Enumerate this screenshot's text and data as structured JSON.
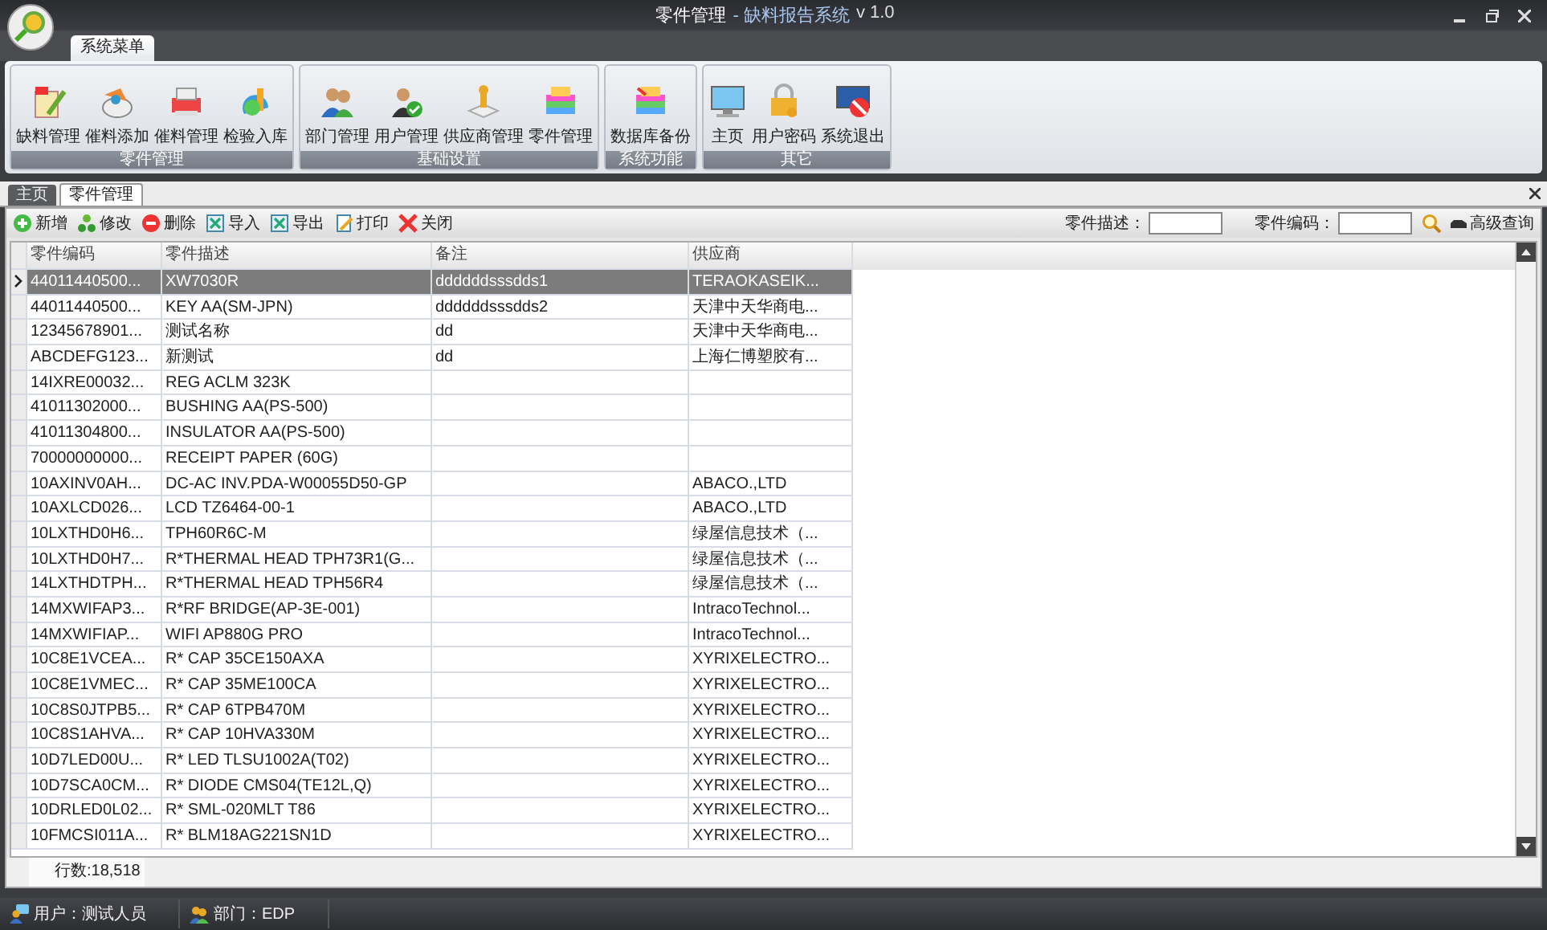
{
  "window": {
    "title": "零件管理",
    "app_name": "- 缺料报告系统",
    "version": "v 1.0"
  },
  "menu_tab": {
    "label": "系统菜单",
    "selected": true
  },
  "ribbon": [
    {
      "label": "零件管理",
      "buttons": [
        "缺料管理",
        "催料添加",
        "催料管理",
        "检验入库"
      ]
    },
    {
      "label": "基础设置",
      "buttons": [
        "部门管理",
        "用户管理",
        "供应商管理",
        "零件管理"
      ]
    },
    {
      "label": "系统功能",
      "buttons": [
        "数据库备份"
      ]
    },
    {
      "label": "其它",
      "buttons": [
        "主页",
        "用户密码",
        "系统退出"
      ]
    }
  ],
  "doc_tabs": [
    {
      "label": "主页",
      "selected": false
    },
    {
      "label": "零件管理",
      "selected": true
    }
  ],
  "toolbar": [
    "新增",
    "修改",
    "删除",
    "导入",
    "导出",
    "打印",
    "关闭"
  ],
  "search": {
    "fields": [
      {
        "label": "零件描述："
      },
      {
        "label": "零件编码："
      }
    ],
    "advanced": "高级查询"
  },
  "table": {
    "columns": [
      "零件编码",
      "零件描述",
      "备注",
      "供应商"
    ],
    "rows": [
      {
        "cells": [
          "44011440500...",
          "XW7030R",
          "ddddddsssdds1",
          "TERAOKASEIK..."
        ],
        "selected": true
      },
      {
        "cells": [
          "44011440500...",
          "KEY AA(SM-JPN)",
          "ddddddsssdds2",
          "天津中天华商电..."
        ],
        "selected": false
      },
      {
        "cells": [
          "12345678901...",
          "测试名称",
          "dd",
          "天津中天华商电..."
        ],
        "selected": false
      },
      {
        "cells": [
          "ABCDEFG123...",
          "新测试",
          "dd",
          "上海仁博塑胶有..."
        ],
        "selected": false
      },
      {
        "cells": [
          "14IXRE00032...",
          "REG ACLM 323K",
          "",
          ""
        ],
        "selected": false
      },
      {
        "cells": [
          "41011302000...",
          "BUSHING AA(PS-500)",
          "",
          ""
        ],
        "selected": false
      },
      {
        "cells": [
          "41011304800...",
          "INSULATOR AA(PS-500)",
          "",
          ""
        ],
        "selected": false
      },
      {
        "cells": [
          "70000000000...",
          "RECEIPT PAPER (60G)",
          "",
          ""
        ],
        "selected": false
      },
      {
        "cells": [
          "10AXINV0AH...",
          "DC-AC INV.PDA-W00055D50-GP",
          "",
          "ABACO.,LTD"
        ],
        "selected": false
      },
      {
        "cells": [
          "10AXLCD026...",
          "LCD TZ6464-00-1",
          "",
          "ABACO.,LTD"
        ],
        "selected": false
      },
      {
        "cells": [
          "10LXTHD0H6...",
          "TPH60R6C-M",
          "",
          "绿屋信息技术（..."
        ],
        "selected": false
      },
      {
        "cells": [
          "10LXTHD0H7...",
          "R*THERMAL HEAD TPH73R1(G...",
          "",
          "绿屋信息技术（..."
        ],
        "selected": false
      },
      {
        "cells": [
          "14LXTHDTPH...",
          "R*THERMAL HEAD TPH56R4",
          "",
          "绿屋信息技术（..."
        ],
        "selected": false
      },
      {
        "cells": [
          "14MXWIFAP3...",
          "R*RF BRIDGE(AP-3E-001)",
          "",
          "IntracoTechnol..."
        ],
        "selected": false
      },
      {
        "cells": [
          "14MXWIFIAP...",
          "WIFI AP880G PRO",
          "",
          "IntracoTechnol..."
        ],
        "selected": false
      },
      {
        "cells": [
          "10C8E1VCEA...",
          "R* CAP 35CE150AXA",
          "",
          "XYRIXELECTRO..."
        ],
        "selected": false
      },
      {
        "cells": [
          "10C8E1VMEC...",
          "R* CAP 35ME100CA",
          "",
          "XYRIXELECTRO..."
        ],
        "selected": false
      },
      {
        "cells": [
          "10C8S0JTPB5...",
          "R* CAP 6TPB470M",
          "",
          "XYRIXELECTRO..."
        ],
        "selected": false
      },
      {
        "cells": [
          "10C8S1AHVA...",
          "R* CAP 10HVA330M",
          "",
          "XYRIXELECTRO..."
        ],
        "selected": false
      },
      {
        "cells": [
          "10D7LED00U...",
          "R* LED TLSU1002A(T02)",
          "",
          "XYRIXELECTRO..."
        ],
        "selected": false
      },
      {
        "cells": [
          "10D7SCA0CM...",
          "R* DIODE CMS04(TE12L,Q)",
          "",
          "XYRIXELECTRO..."
        ],
        "selected": false
      },
      {
        "cells": [
          "10DRLED0L02...",
          "R* SML-020MLT T86",
          "",
          "XYRIXELECTRO..."
        ],
        "selected": false
      },
      {
        "cells": [
          "10FMCSI011A...",
          "R* BLM18AG221SN1D",
          "",
          "XYRIXELECTRO..."
        ],
        "selected": false
      }
    ],
    "row_count": "行数:18,518"
  },
  "status_bar": [
    {
      "kind": "user",
      "text": "用户：测试人员"
    },
    {
      "kind": "dept",
      "text": "部门：EDP"
    }
  ]
}
